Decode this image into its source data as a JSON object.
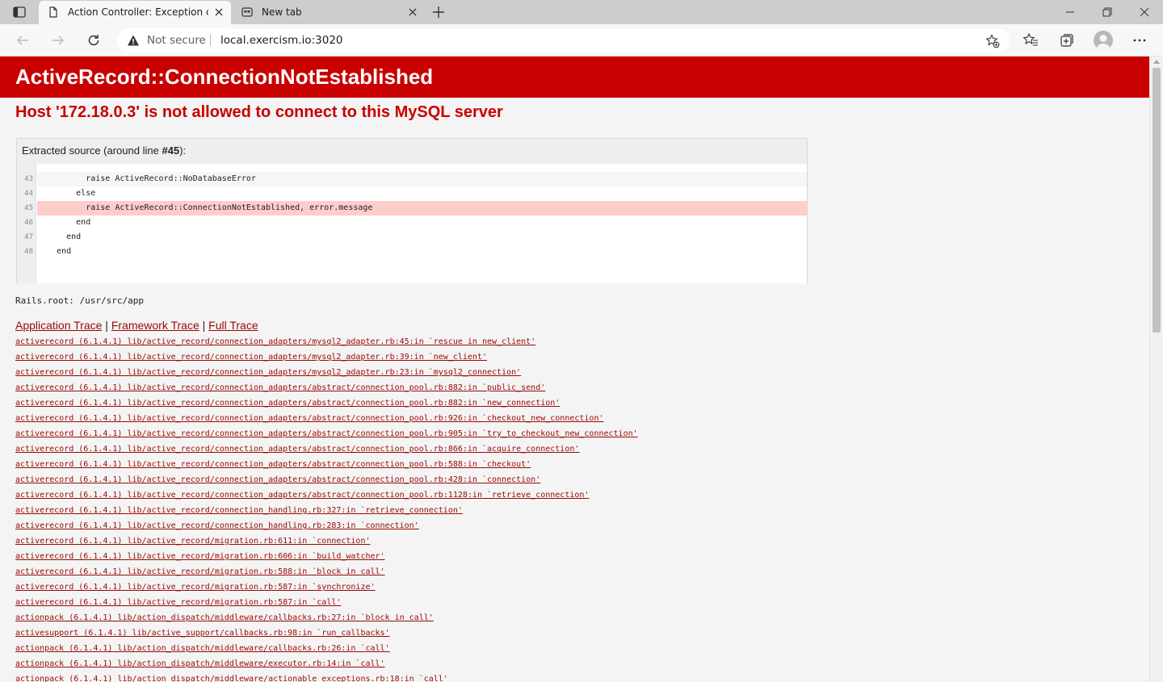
{
  "browser": {
    "tabs": [
      {
        "title": "Action Controller: Exception caught",
        "icon": "page-icon",
        "active": true
      },
      {
        "title": "New tab",
        "icon": "new-tab-page-icon",
        "active": false
      }
    ],
    "security_label": "Not secure",
    "url": "local.exercism.io:3020"
  },
  "page": {
    "error_class": "ActiveRecord::ConnectionNotEstablished",
    "error_message": "Host '172.18.0.3' is not allowed to connect to this MySQL server",
    "source": {
      "header_prefix": "Extracted source (around line ",
      "header_line": "#45",
      "header_suffix": "):",
      "lines": [
        {
          "num": "43",
          "code": "          raise ActiveRecord::NoDatabaseError",
          "highlight": false
        },
        {
          "num": "44",
          "code": "        else",
          "highlight": false
        },
        {
          "num": "45",
          "code": "          raise ActiveRecord::ConnectionNotEstablished, error.message",
          "highlight": true
        },
        {
          "num": "46",
          "code": "        end",
          "highlight": false
        },
        {
          "num": "47",
          "code": "      end",
          "highlight": false
        },
        {
          "num": "48",
          "code": "    end",
          "highlight": false
        }
      ]
    },
    "rails_root": "Rails.root: /usr/src/app",
    "trace_nav": {
      "application": "Application Trace",
      "framework": "Framework Trace",
      "full": "Full Trace",
      "separator": " | "
    },
    "trace": [
      "activerecord (6.1.4.1) lib/active_record/connection_adapters/mysql2_adapter.rb:45:in `rescue in new_client'",
      "activerecord (6.1.4.1) lib/active_record/connection_adapters/mysql2_adapter.rb:39:in `new_client'",
      "activerecord (6.1.4.1) lib/active_record/connection_adapters/mysql2_adapter.rb:23:in `mysql2_connection'",
      "activerecord (6.1.4.1) lib/active_record/connection_adapters/abstract/connection_pool.rb:882:in `public_send'",
      "activerecord (6.1.4.1) lib/active_record/connection_adapters/abstract/connection_pool.rb:882:in `new_connection'",
      "activerecord (6.1.4.1) lib/active_record/connection_adapters/abstract/connection_pool.rb:926:in `checkout_new_connection'",
      "activerecord (6.1.4.1) lib/active_record/connection_adapters/abstract/connection_pool.rb:905:in `try_to_checkout_new_connection'",
      "activerecord (6.1.4.1) lib/active_record/connection_adapters/abstract/connection_pool.rb:866:in `acquire_connection'",
      "activerecord (6.1.4.1) lib/active_record/connection_adapters/abstract/connection_pool.rb:588:in `checkout'",
      "activerecord (6.1.4.1) lib/active_record/connection_adapters/abstract/connection_pool.rb:428:in `connection'",
      "activerecord (6.1.4.1) lib/active_record/connection_adapters/abstract/connection_pool.rb:1128:in `retrieve_connection'",
      "activerecord (6.1.4.1) lib/active_record/connection_handling.rb:327:in `retrieve_connection'",
      "activerecord (6.1.4.1) lib/active_record/connection_handling.rb:283:in `connection'",
      "activerecord (6.1.4.1) lib/active_record/migration.rb:611:in `connection'",
      "activerecord (6.1.4.1) lib/active_record/migration.rb:606:in `build_watcher'",
      "activerecord (6.1.4.1) lib/active_record/migration.rb:588:in `block in call'",
      "activerecord (6.1.4.1) lib/active_record/migration.rb:587:in `synchronize'",
      "activerecord (6.1.4.1) lib/active_record/migration.rb:587:in `call'",
      "actionpack (6.1.4.1) lib/action_dispatch/middleware/callbacks.rb:27:in `block in call'",
      "activesupport (6.1.4.1) lib/active_support/callbacks.rb:98:in `run_callbacks'",
      "actionpack (6.1.4.1) lib/action_dispatch/middleware/callbacks.rb:26:in `call'",
      "actionpack (6.1.4.1) lib/action_dispatch/middleware/executor.rb:14:in `call'",
      "actionpack (6.1.4.1) lib/action_dispatch/middleware/actionable_exceptions.rb:18:in `call'"
    ]
  }
}
